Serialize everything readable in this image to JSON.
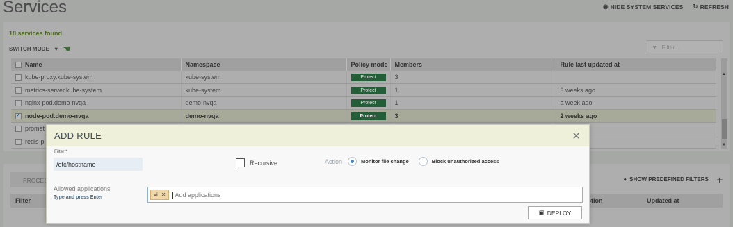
{
  "page": {
    "title": "Services"
  },
  "top_actions": {
    "hide_system": "HIDE SYSTEM SERVICES",
    "refresh": "REFRESH"
  },
  "services": {
    "count_text": "18 services found",
    "switch_mode": "SWITCH MODE",
    "filter_placeholder": "Filter...",
    "columns": [
      "Name",
      "Namespace",
      "Policy mode",
      "Members",
      "Rule last updated at"
    ],
    "rows": [
      {
        "name": "kube-proxy.kube-system",
        "namespace": "kube-system",
        "mode": "Protect",
        "members": "3",
        "updated": "",
        "checked": false
      },
      {
        "name": "metrics-server.kube-system",
        "namespace": "kube-system",
        "mode": "Protect",
        "members": "1",
        "updated": "3 weeks ago",
        "checked": false
      },
      {
        "name": "nginx-pod.demo-nvqa",
        "namespace": "demo-nvqa",
        "mode": "Protect",
        "members": "1",
        "updated": "a week ago",
        "checked": false
      },
      {
        "name": "node-pod.demo-nvqa",
        "namespace": "demo-nvqa",
        "mode": "Protect",
        "members": "3",
        "updated": "2 weeks ago",
        "checked": true
      },
      {
        "name": "promet",
        "namespace": "",
        "mode": "",
        "members": "",
        "updated": "",
        "checked": false
      },
      {
        "name": "redis-p",
        "namespace": "",
        "mode": "",
        "members": "",
        "updated": "",
        "checked": false
      }
    ]
  },
  "lower": {
    "tab": "PROCESS",
    "show_predefined": "SHOW PREDEFINED FILTERS",
    "columns": {
      "filter": "Filter",
      "action": "ction",
      "updated": "Updated at"
    }
  },
  "modal": {
    "title": "ADD RULE",
    "filter_label": "Filter *",
    "filter_value": "/etc/hostname",
    "recursive_label": "Recursive",
    "action_label": "Action",
    "monitor_label": "Monitor file change",
    "block_label": "Block unauthorized access",
    "allowed_label": "Allowed applications",
    "allowed_hint": "Type and press Enter",
    "chip": "vi",
    "apps_placeholder": "Add applications",
    "deploy_label": "DEPLOY"
  },
  "colors": {
    "protect_badge": "#245e38",
    "selected_row": "#a7aa99",
    "modal_header": "#eef0da"
  }
}
